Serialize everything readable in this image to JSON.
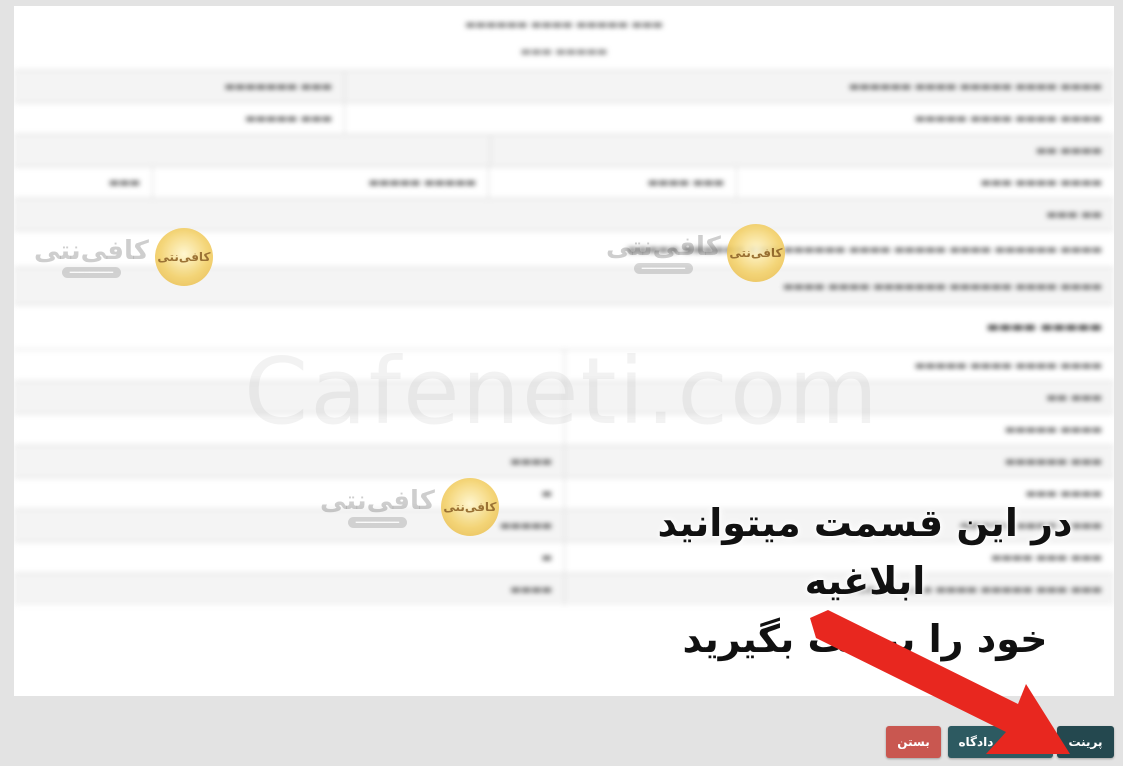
{
  "watermark": {
    "domain": "Cafeneti.com",
    "logo_name": "کافی‌نتی",
    "logo_badge": "کافی‌نتی"
  },
  "instruction": {
    "line1": "در این قسمت میتوانید ابلاغیه",
    "line2": "خود را پرینت بگیرید"
  },
  "buttons": {
    "print": "پرینت",
    "objection": "اعتراض دادگاه",
    "close": "بستن"
  },
  "colors": {
    "print_button": "#24484f",
    "objection_button": "#2d5a61",
    "close_button": "#c95750",
    "arrow": "#e8271f"
  }
}
